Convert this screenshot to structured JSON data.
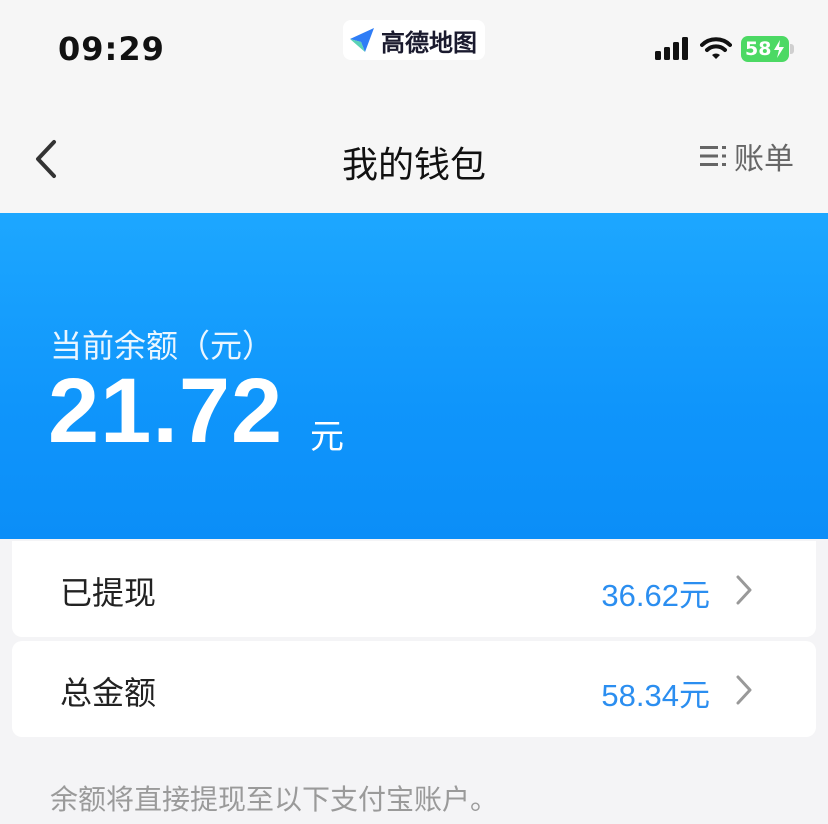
{
  "status_bar": {
    "time": "09:29",
    "app_name": "高德地图",
    "battery": "58"
  },
  "nav": {
    "title": "我的钱包",
    "bill_label": "账单"
  },
  "balance": {
    "label": "当前余额（元）",
    "amount": "21.72",
    "unit": "元"
  },
  "rows": [
    {
      "label": "已提现",
      "value": "36.62元"
    },
    {
      "label": "总金额",
      "value": "58.34元"
    }
  ],
  "note": "余额将直接提现至以下支付宝账户。",
  "colors": {
    "accent": "#0f95fb",
    "value_blue": "#2b8ef0",
    "battery_green": "#4cd964"
  },
  "icons": [
    "amap-logo-icon",
    "signal-icon",
    "wifi-icon",
    "bolt-icon",
    "back-chevron-icon",
    "list-icon",
    "chevron-right-icon"
  ]
}
